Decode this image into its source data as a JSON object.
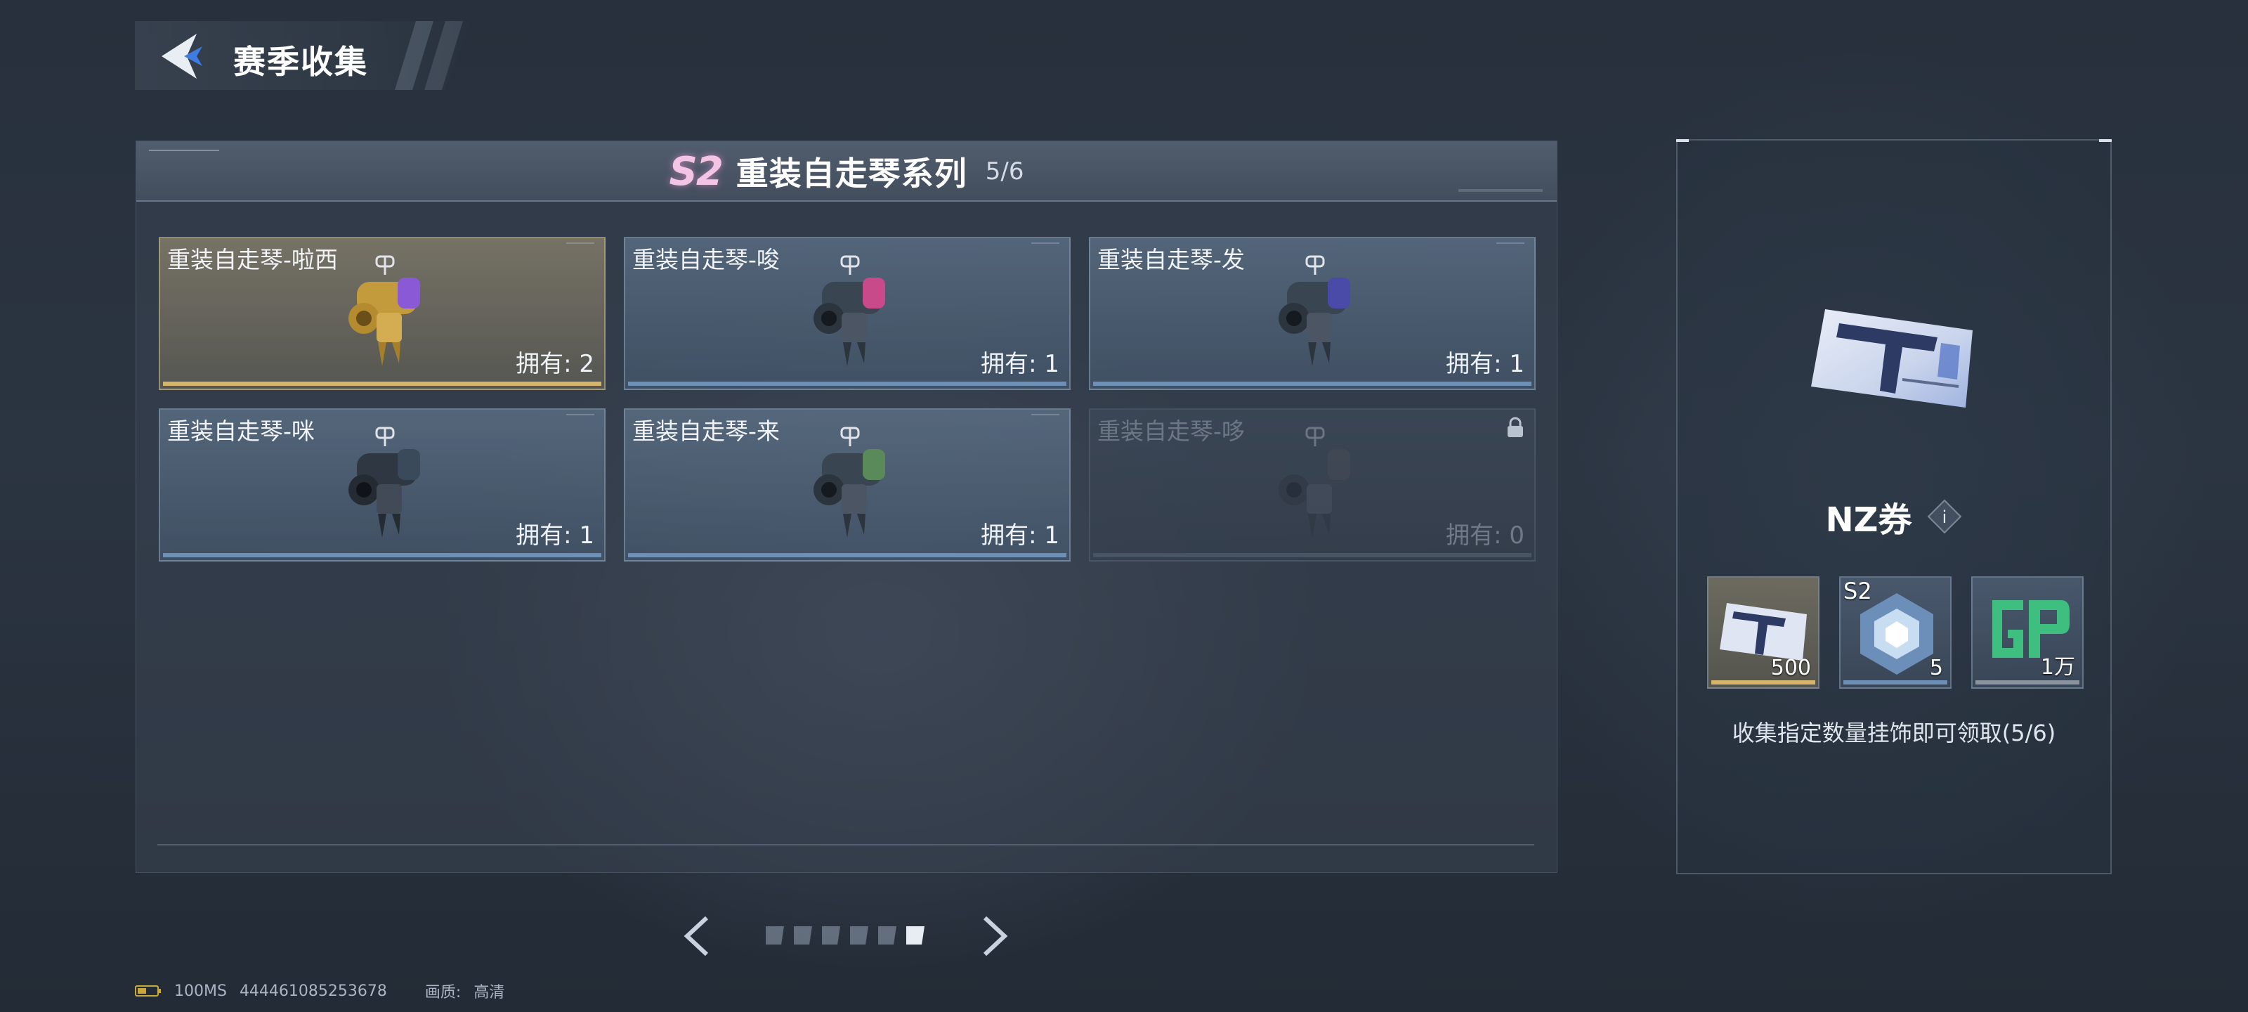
{
  "header": {
    "title": "赛季收集"
  },
  "series": {
    "season": "S2",
    "title": "重装自走琴系列",
    "progress": "5/6"
  },
  "cards": [
    {
      "name": "重装自走琴-啦西",
      "count": "拥有: 2",
      "rarity": "gold",
      "locked": false,
      "accent": "#8a5ad6"
    },
    {
      "name": "重装自走琴-唆",
      "count": "拥有: 1",
      "rarity": "blue",
      "locked": false,
      "accent": "#c84a8a"
    },
    {
      "name": "重装自走琴-发",
      "count": "拥有: 1",
      "rarity": "blue",
      "locked": false,
      "accent": "#4a4aa8"
    },
    {
      "name": "重装自走琴-咪",
      "count": "拥有: 1",
      "rarity": "blue",
      "locked": false,
      "accent": "#3a4a5a"
    },
    {
      "name": "重装自走琴-来",
      "count": "拥有: 1",
      "rarity": "blue",
      "locked": false,
      "accent": "#5a8a5a"
    },
    {
      "name": "重装自走琴-哆",
      "count": "拥有: 0",
      "rarity": "locked",
      "locked": true,
      "accent": "#4a4f58"
    }
  ],
  "pagination": {
    "total_pages": 6,
    "current_page": 6
  },
  "reward": {
    "title": "NZ券",
    "info_icon": "i",
    "items": [
      {
        "icon": "nz-ticket-icon",
        "quantity": "500",
        "rarity": "gold",
        "tag": ""
      },
      {
        "icon": "s2-crystal-icon",
        "quantity": "5",
        "rarity": "blue",
        "tag": "S2"
      },
      {
        "icon": "gp-icon",
        "quantity": "1万",
        "rarity": "grey",
        "tag": ""
      }
    ],
    "description": "收集指定数量挂饰即可领取(5/6)"
  },
  "status_bar": {
    "ping": "100MS",
    "player_id": "444461085253678",
    "quality_label": "画质:",
    "quality_value": "高清"
  },
  "colors": {
    "gold_bar": "#d6b46a",
    "blue_bar": "#6d90b8",
    "season_badge": "#f4c4e4"
  }
}
